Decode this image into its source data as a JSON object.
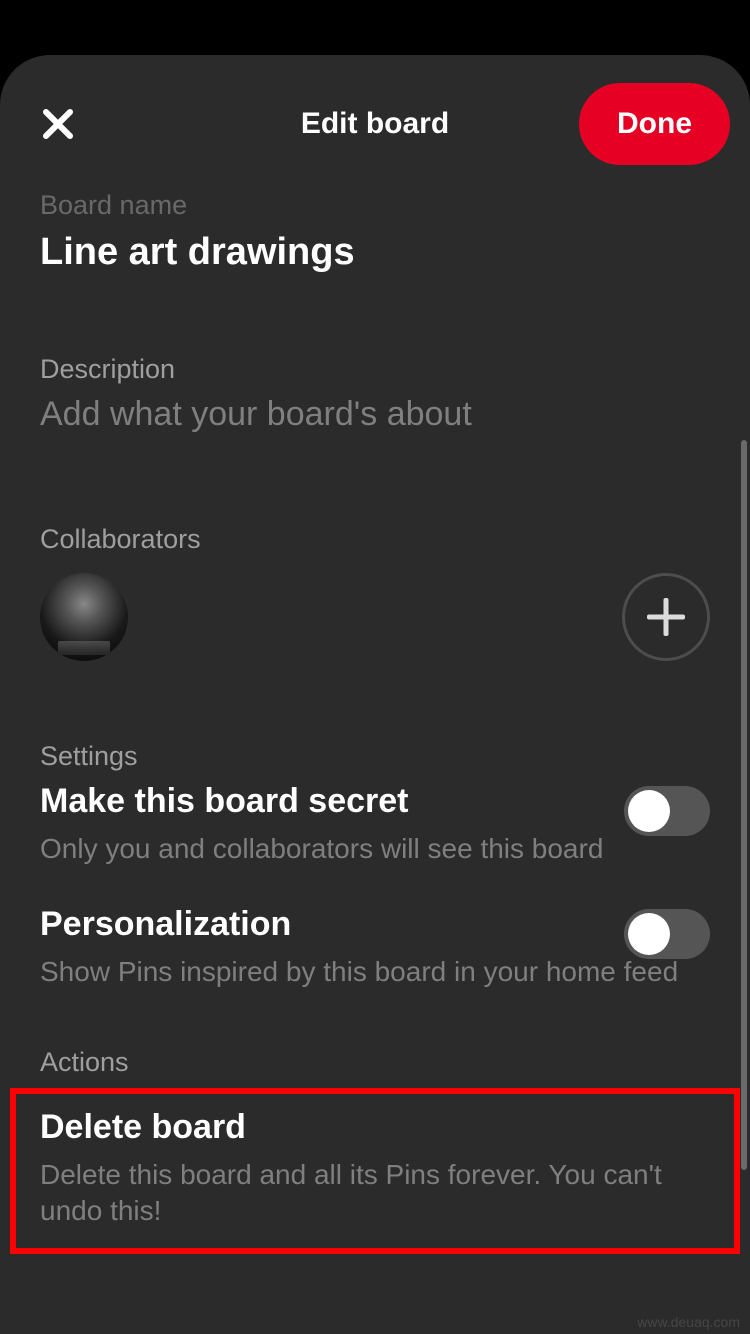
{
  "header": {
    "title": "Edit board",
    "done_label": "Done"
  },
  "boardName": {
    "label": "Board name",
    "value": "Line art drawings"
  },
  "description": {
    "label": "Description",
    "placeholder": "Add what your board's about"
  },
  "collaborators": {
    "label": "Collaborators"
  },
  "settings": {
    "label": "Settings",
    "secret": {
      "title": "Make this board secret",
      "desc": "Only you and collaborators will see this board",
      "on": false
    },
    "personalization": {
      "title": "Personalization",
      "desc": "Show Pins inspired by this board in your home feed",
      "on": false
    }
  },
  "actions": {
    "label": "Actions",
    "delete": {
      "title": "Delete board",
      "desc": "Delete this board and all its Pins forever. You can't undo this!"
    }
  },
  "watermark": "www.deuaq.com"
}
